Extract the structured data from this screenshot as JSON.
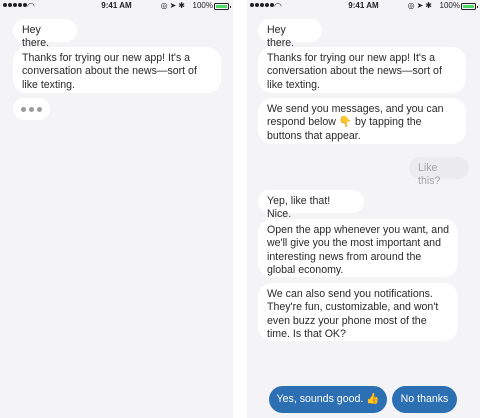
{
  "status_bar": {
    "time": "9:41 AM",
    "battery": "100%",
    "icons": [
      "wifi-icon",
      "alarm-icon",
      "location-icon",
      "bluetooth-icon",
      "battery-icon"
    ]
  },
  "left_screen": {
    "messages": [
      "Hey there.",
      "Thanks for trying our new app! It's a conversation about the news—sort of like texting."
    ]
  },
  "right_screen": {
    "messages": [
      "Hey there.",
      "Thanks for trying our new app! It's a conversation about the news—sort of like texting.",
      "We send you messages, and you can respond below 👇 by tapping the buttons that appear.",
      "Like this?",
      "Yep, like that! Nice.",
      "Open the app whenever you want, and we'll give you the most important and interesting news from around the global economy.",
      "We can also send you notifications. They're fun, customizable, and won't even buzz your phone most of the time. Is that OK?"
    ],
    "buttons": {
      "accept": "Yes, sounds good. 👍",
      "decline": "No thanks"
    }
  },
  "colors": {
    "background": "#f4f4f6",
    "bubble": "#ffffff",
    "user_bubble": "#ececef",
    "button": "#2c6fb3",
    "battery": "#4cd964"
  }
}
